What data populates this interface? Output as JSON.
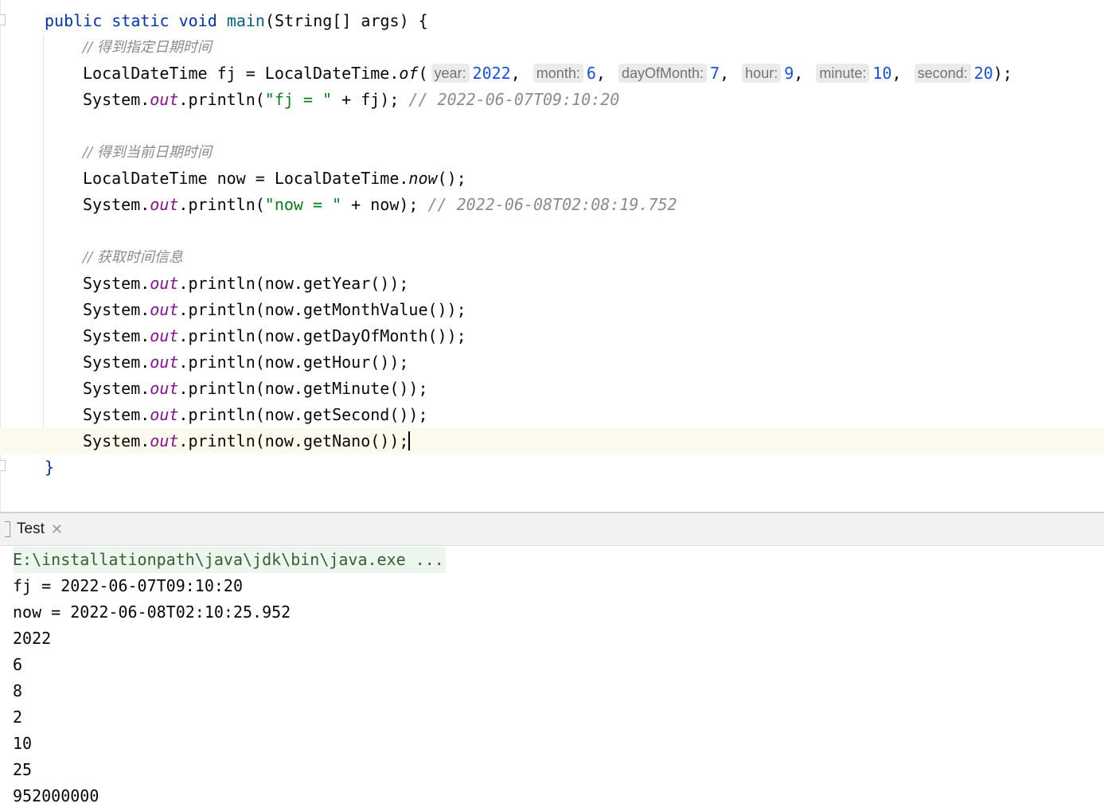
{
  "editor": {
    "code": {
      "method_signature": {
        "kw1": "public",
        "kw2": "static",
        "kw3": "void",
        "name": "main",
        "params_type": "String[]",
        "params_name": "args",
        "open_brace": "{"
      },
      "comment1": "// 得到指定日期时间",
      "line_of": {
        "lhs": "LocalDateTime fj = LocalDateTime.",
        "method": "of",
        "hints": [
          {
            "label": "year:",
            "value": "2022"
          },
          {
            "label": "month:",
            "value": "6"
          },
          {
            "label": "dayOfMonth:",
            "value": "7"
          },
          {
            "label": "hour:",
            "value": "9"
          },
          {
            "label": "minute:",
            "value": "10"
          },
          {
            "label": "second:",
            "value": "20"
          }
        ]
      },
      "print_fj": {
        "prefix": "System.",
        "field": "out",
        "call": ".println(",
        "str": "\"fj = \"",
        "rest": " + fj); ",
        "comment": "// 2022-06-07T09:10:20"
      },
      "comment2": "// 得到当前日期时间",
      "line_now": {
        "lhs": "LocalDateTime now = LocalDateTime.",
        "method": "now",
        "rest": "();"
      },
      "print_now": {
        "prefix": "System.",
        "field": "out",
        "call": ".println(",
        "str": "\"now = \"",
        "rest": " + now); ",
        "comment": "// 2022-06-08T02:08:19.752"
      },
      "comment3": "// 获取时间信息",
      "getters": [
        "now.getYear()",
        "now.getMonthValue()",
        "now.getDayOfMonth()",
        "now.getHour()",
        "now.getMinute()",
        "now.getSecond()",
        "now.getNano()"
      ],
      "close_brace": "}"
    }
  },
  "run_panel": {
    "tab_label": "Test",
    "command_line": "E:\\installationpath\\java\\jdk\\bin\\java.exe ...",
    "output": [
      "fj = 2022-06-07T09:10:20",
      "now = 2022-06-08T02:10:25.952",
      "2022",
      "6",
      "8",
      "2",
      "10",
      "25",
      "952000000"
    ]
  }
}
